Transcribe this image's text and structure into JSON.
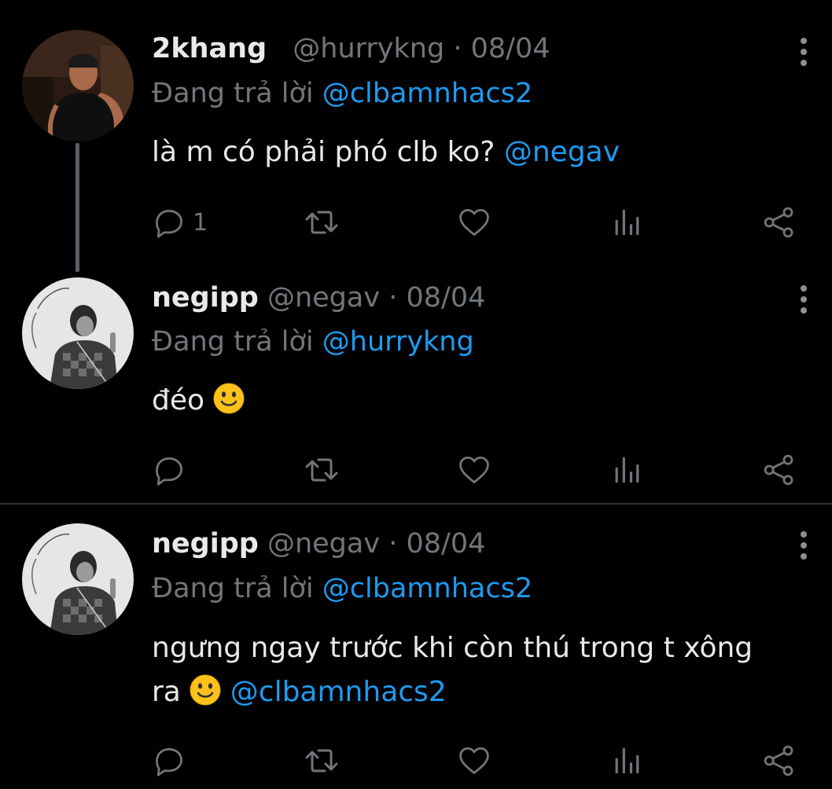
{
  "colors": {
    "background": "#000000",
    "text": "#e7e9ea",
    "muted": "#71767b",
    "link": "#1d9bf0",
    "divider": "#2f3336"
  },
  "tweets": [
    {
      "display_name": "2khang",
      "handle": "@hurrykng",
      "separator": "·",
      "date": "08/04",
      "replying_prefix": "Đang trả lời",
      "replying_to": "@clbamnhacs2",
      "text": "là m có phải phó clb ko?",
      "mention": "@negav",
      "reply_count": "1",
      "avatar_icon": "avatar-photo"
    },
    {
      "display_name": "negipp",
      "handle": "@negav",
      "separator": "·",
      "date": "08/04",
      "replying_prefix": "Đang trả lời",
      "replying_to": "@hurrykng",
      "text": "đéo",
      "emoji": "slightly-smiling-face-emoji",
      "reply_count": "",
      "avatar_icon": "avatar-photo"
    },
    {
      "display_name": "negipp",
      "handle": "@negav",
      "separator": "·",
      "date": "08/04",
      "replying_prefix": "Đang trả lời",
      "replying_to": "@clbamnhacs2",
      "text_line1": "ngưng ngay trước khi còn thú trong t xông",
      "text_line2": "ra",
      "emoji": "slightly-smiling-face-emoji",
      "mention": "@clbamnhacs2",
      "reply_count": "",
      "avatar_icon": "avatar-photo"
    }
  ],
  "action_icons": [
    "reply-icon",
    "retweet-icon",
    "like-icon",
    "analytics-icon",
    "share-icon",
    "more-icon"
  ]
}
